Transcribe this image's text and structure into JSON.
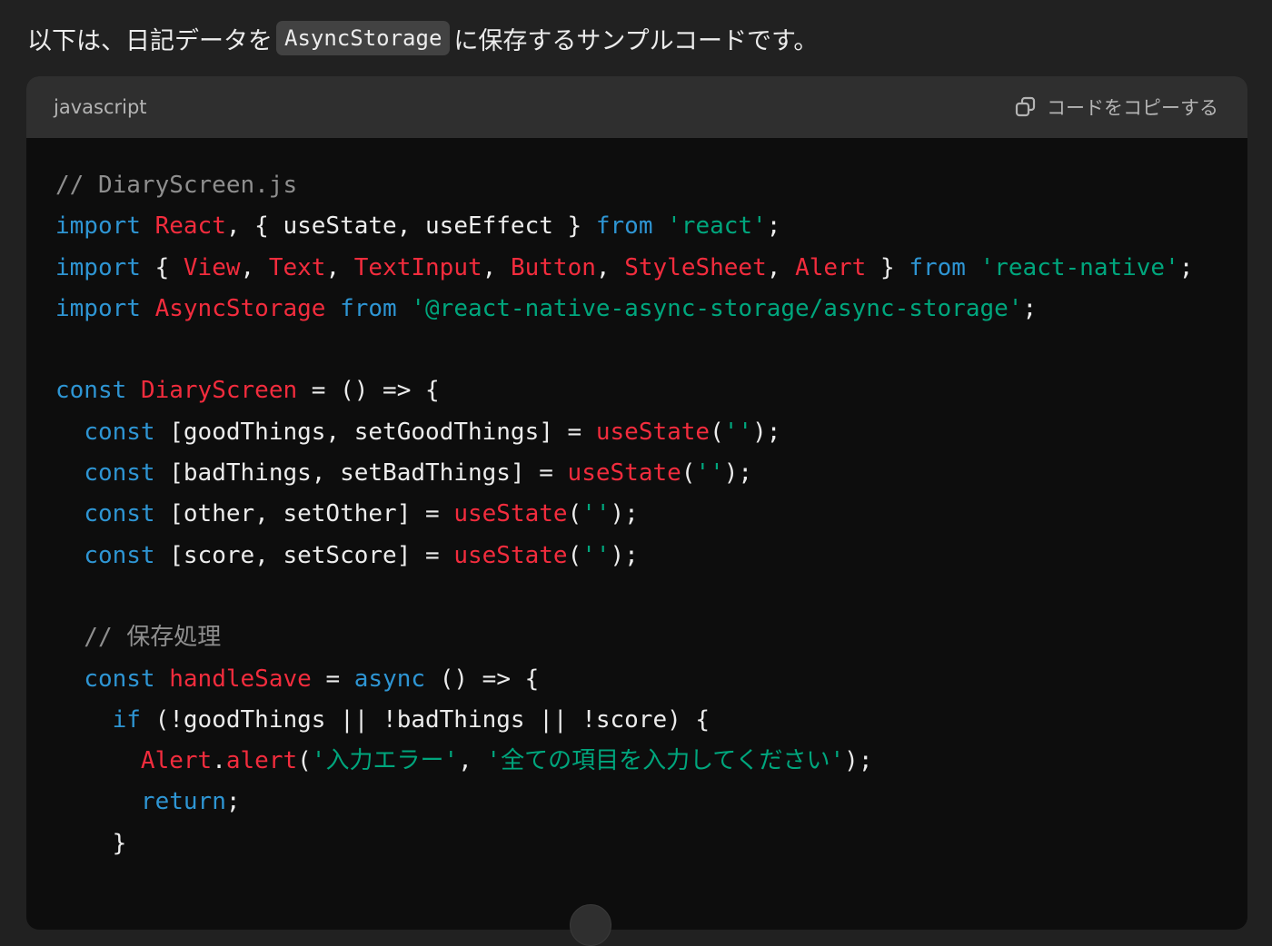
{
  "intro": {
    "before": "以下は、日記データを",
    "inline_code": "AsyncStorage",
    "after": "に保存するサンプルコードです。"
  },
  "code_block": {
    "language": "javascript",
    "copy_label": "コードをコピーする",
    "lines": [
      [
        {
          "t": "// DiaryScreen.js",
          "c": "c"
        }
      ],
      [
        {
          "t": "import",
          "c": "k"
        },
        {
          "t": " ",
          "c": "p"
        },
        {
          "t": "React",
          "c": "t"
        },
        {
          "t": ", { useState, useEffect } ",
          "c": "p"
        },
        {
          "t": "from",
          "c": "k"
        },
        {
          "t": " ",
          "c": "p"
        },
        {
          "t": "'react'",
          "c": "s"
        },
        {
          "t": ";",
          "c": "p"
        }
      ],
      [
        {
          "t": "import",
          "c": "k"
        },
        {
          "t": " { ",
          "c": "p"
        },
        {
          "t": "View",
          "c": "t"
        },
        {
          "t": ", ",
          "c": "p"
        },
        {
          "t": "Text",
          "c": "t"
        },
        {
          "t": ", ",
          "c": "p"
        },
        {
          "t": "TextInput",
          "c": "t"
        },
        {
          "t": ", ",
          "c": "p"
        },
        {
          "t": "Button",
          "c": "t"
        },
        {
          "t": ", ",
          "c": "p"
        },
        {
          "t": "StyleSheet",
          "c": "t"
        },
        {
          "t": ", ",
          "c": "p"
        },
        {
          "t": "Alert",
          "c": "t"
        },
        {
          "t": " } ",
          "c": "p"
        },
        {
          "t": "from",
          "c": "k"
        },
        {
          "t": " ",
          "c": "p"
        },
        {
          "t": "'react-native'",
          "c": "s"
        },
        {
          "t": ";",
          "c": "p"
        }
      ],
      [
        {
          "t": "import",
          "c": "k"
        },
        {
          "t": " ",
          "c": "p"
        },
        {
          "t": "AsyncStorage",
          "c": "t"
        },
        {
          "t": " ",
          "c": "p"
        },
        {
          "t": "from",
          "c": "k"
        },
        {
          "t": " ",
          "c": "p"
        },
        {
          "t": "'@react-native-async-storage/async-storage'",
          "c": "s"
        },
        {
          "t": ";",
          "c": "p"
        }
      ],
      [],
      [
        {
          "t": "const",
          "c": "k"
        },
        {
          "t": " ",
          "c": "p"
        },
        {
          "t": "DiaryScreen",
          "c": "t"
        },
        {
          "t": " = () => {",
          "c": "p"
        }
      ],
      [
        {
          "t": "  ",
          "c": "p"
        },
        {
          "t": "const",
          "c": "k"
        },
        {
          "t": " [goodThings, setGoodThings] = ",
          "c": "p"
        },
        {
          "t": "useState",
          "c": "t"
        },
        {
          "t": "(",
          "c": "p"
        },
        {
          "t": "''",
          "c": "s"
        },
        {
          "t": ");",
          "c": "p"
        }
      ],
      [
        {
          "t": "  ",
          "c": "p"
        },
        {
          "t": "const",
          "c": "k"
        },
        {
          "t": " [badThings, setBadThings] = ",
          "c": "p"
        },
        {
          "t": "useState",
          "c": "t"
        },
        {
          "t": "(",
          "c": "p"
        },
        {
          "t": "''",
          "c": "s"
        },
        {
          "t": ");",
          "c": "p"
        }
      ],
      [
        {
          "t": "  ",
          "c": "p"
        },
        {
          "t": "const",
          "c": "k"
        },
        {
          "t": " [other, setOther] = ",
          "c": "p"
        },
        {
          "t": "useState",
          "c": "t"
        },
        {
          "t": "(",
          "c": "p"
        },
        {
          "t": "''",
          "c": "s"
        },
        {
          "t": ");",
          "c": "p"
        }
      ],
      [
        {
          "t": "  ",
          "c": "p"
        },
        {
          "t": "const",
          "c": "k"
        },
        {
          "t": " [score, setScore] = ",
          "c": "p"
        },
        {
          "t": "useState",
          "c": "t"
        },
        {
          "t": "(",
          "c": "p"
        },
        {
          "t": "''",
          "c": "s"
        },
        {
          "t": ");",
          "c": "p"
        }
      ],
      [],
      [
        {
          "t": "  // 保存処理",
          "c": "c"
        }
      ],
      [
        {
          "t": "  ",
          "c": "p"
        },
        {
          "t": "const",
          "c": "k"
        },
        {
          "t": " ",
          "c": "p"
        },
        {
          "t": "handleSave",
          "c": "t"
        },
        {
          "t": " = ",
          "c": "p"
        },
        {
          "t": "async",
          "c": "k"
        },
        {
          "t": " () => {",
          "c": "p"
        }
      ],
      [
        {
          "t": "    ",
          "c": "p"
        },
        {
          "t": "if",
          "c": "k"
        },
        {
          "t": " (!goodThings || !badThings || !score) {",
          "c": "p"
        }
      ],
      [
        {
          "t": "      ",
          "c": "p"
        },
        {
          "t": "Alert",
          "c": "t"
        },
        {
          "t": ".",
          "c": "p"
        },
        {
          "t": "alert",
          "c": "t"
        },
        {
          "t": "(",
          "c": "p"
        },
        {
          "t": "'入力エラー'",
          "c": "s"
        },
        {
          "t": ", ",
          "c": "p"
        },
        {
          "t": "'全ての項目を入力してください'",
          "c": "s"
        },
        {
          "t": ");",
          "c": "p"
        }
      ],
      [
        {
          "t": "      ",
          "c": "p"
        },
        {
          "t": "return",
          "c": "k"
        },
        {
          "t": ";",
          "c": "p"
        }
      ],
      [
        {
          "t": "    }",
          "c": "p"
        }
      ]
    ]
  },
  "colors": {
    "page_bg": "#212121",
    "code_bg": "#0d0d0d",
    "header_bg": "#2f2f2f",
    "keyword": "#2e95d3",
    "identifier": "#f22c3d",
    "string": "#00a67d",
    "comment": "#8e8e8e",
    "plain": "#ececec"
  }
}
